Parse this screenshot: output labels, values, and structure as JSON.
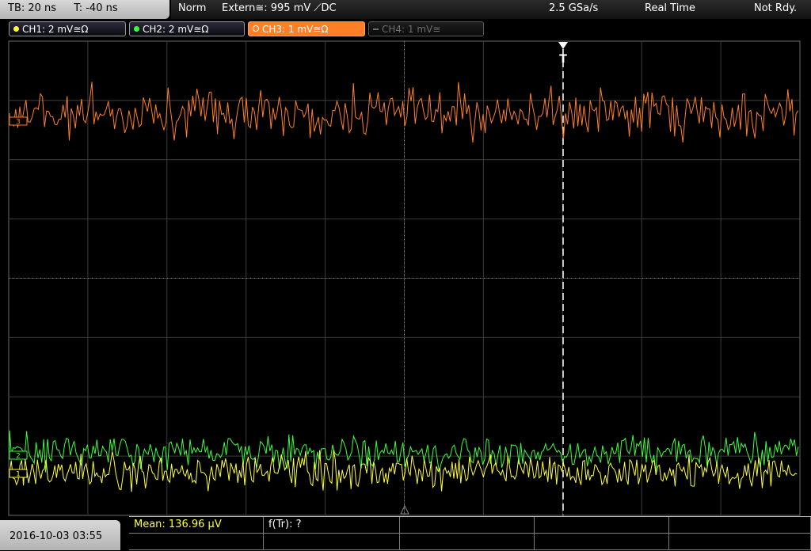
{
  "header": {
    "timebase": "TB: 20 ns",
    "trigger_time": "T: -40 ns",
    "trigger_mode": "Norm",
    "trigger_source": "Extern≅: 995 mV ⟋DC",
    "sample_rate": "2.5 GSa/s",
    "acq_mode": "Real Time",
    "status": "Not Rdy."
  },
  "channels": [
    {
      "label": "CH1: 2 mV≅Ω",
      "color": "#ffff3c",
      "state": "on"
    },
    {
      "label": "CH2: 2 mV≅Ω",
      "color": "#3cff3c",
      "state": "on"
    },
    {
      "label": "CH3: 1 mV≅Ω",
      "color": "#ff7f28",
      "state": "active"
    },
    {
      "label": "CH4: 1 mV≅",
      "color": "#6e6e6e",
      "state": "off"
    }
  ],
  "scope": {
    "trigger_marker": "T",
    "channel_markers": [
      "1",
      "2",
      "3"
    ]
  },
  "footer": {
    "datetime": "2016-10-03 03:55",
    "measurements": [
      "Mean: 136.96 µV",
      "f(Tr): ?"
    ]
  },
  "colors": {
    "ch1": "#ffff3c",
    "ch2": "#3cff3c",
    "ch3": "#ff7f28",
    "grid": "#3c3c3c",
    "meas_active": "#ffff3c"
  }
}
